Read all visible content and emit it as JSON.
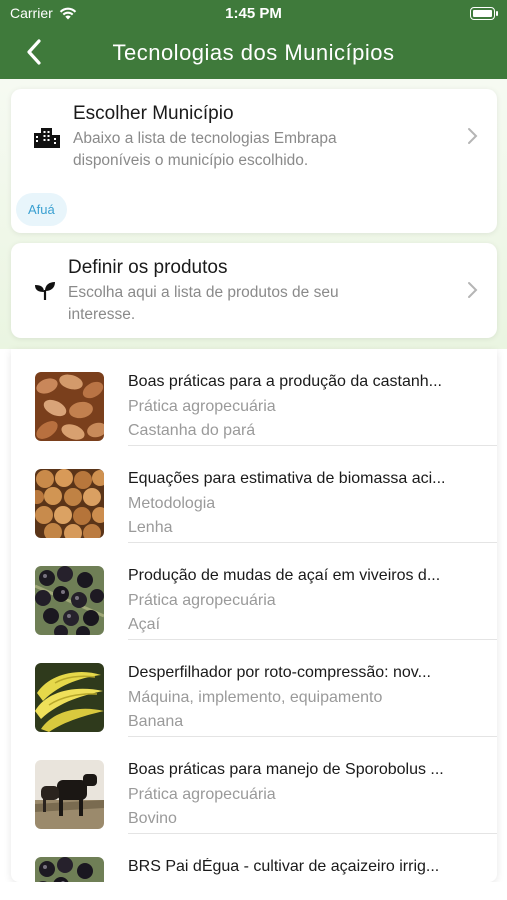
{
  "status": {
    "carrier": "Carrier",
    "time": "1:45 PM"
  },
  "header": {
    "title": "Tecnologias dos Municípios",
    "back_icon": "chevron-left-icon"
  },
  "municipio_card": {
    "title": "Escolher Município",
    "subtitle": "Abaixo a lista de tecnologias Embrapa disponíveis o município escolhido.",
    "chip": "Afuá",
    "icon": "buildings-icon"
  },
  "produtos_card": {
    "title": "Definir os produtos",
    "subtitle": "Escolha aqui a lista de produtos de seu interesse.",
    "icon": "sprout-icon"
  },
  "colors": {
    "header": "#3f7a3b",
    "chip_bg": "#e8f5fb",
    "chip_text": "#3aa0d1"
  },
  "items": [
    {
      "title": "Boas práticas para a produção da castanh...",
      "type": "Prática agropecuária",
      "product": "Castanha do pará",
      "thumb": "castanha"
    },
    {
      "title": "Equações para estimativa de biomassa aci...",
      "type": "Metodologia",
      "product": "Lenha",
      "thumb": "lenha"
    },
    {
      "title": "Produção de mudas de açaí em viveiros d...",
      "type": "Prática agropecuária",
      "product": "Açaí",
      "thumb": "acai"
    },
    {
      "title": "Desperfilhador por roto-compressão: nov...",
      "type": "Máquina, implemento, equipamento",
      "product": "Banana",
      "thumb": "banana"
    },
    {
      "title": "Boas práticas para manejo de Sporobolus ...",
      "type": "Prática agropecuária",
      "product": "Bovino",
      "thumb": "bovino"
    },
    {
      "title": "BRS Pai dÉgua - cultivar de açaizeiro irrig...",
      "type": "",
      "product": "",
      "thumb": "acai"
    }
  ]
}
